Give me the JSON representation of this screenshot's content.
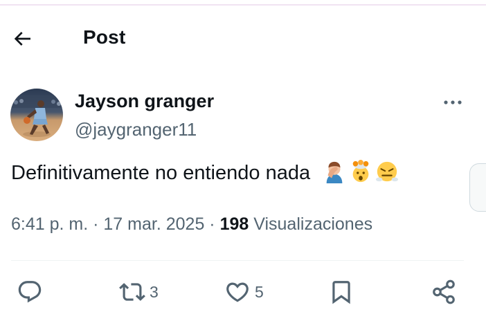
{
  "header": {
    "title": "Post"
  },
  "author": {
    "display_name": "Jayson granger",
    "handle": "@jaygranger11"
  },
  "tweet": {
    "text": "Definitivamente no entiendo nada",
    "emojis": [
      "facepalm-man-icon",
      "exploding-head-icon",
      "triumph-face-icon"
    ]
  },
  "meta": {
    "time": "6:41 p. m.",
    "sep1": "·",
    "date": "17 mar. 2025",
    "sep2": "·",
    "views_count": "198",
    "views_label": "Visualizaciones"
  },
  "actions": {
    "reply_count": "",
    "retweet_count": "3",
    "like_count": "5"
  },
  "colors": {
    "text": "#0f1419",
    "secondary": "#536471",
    "divider": "#eff3f4"
  }
}
